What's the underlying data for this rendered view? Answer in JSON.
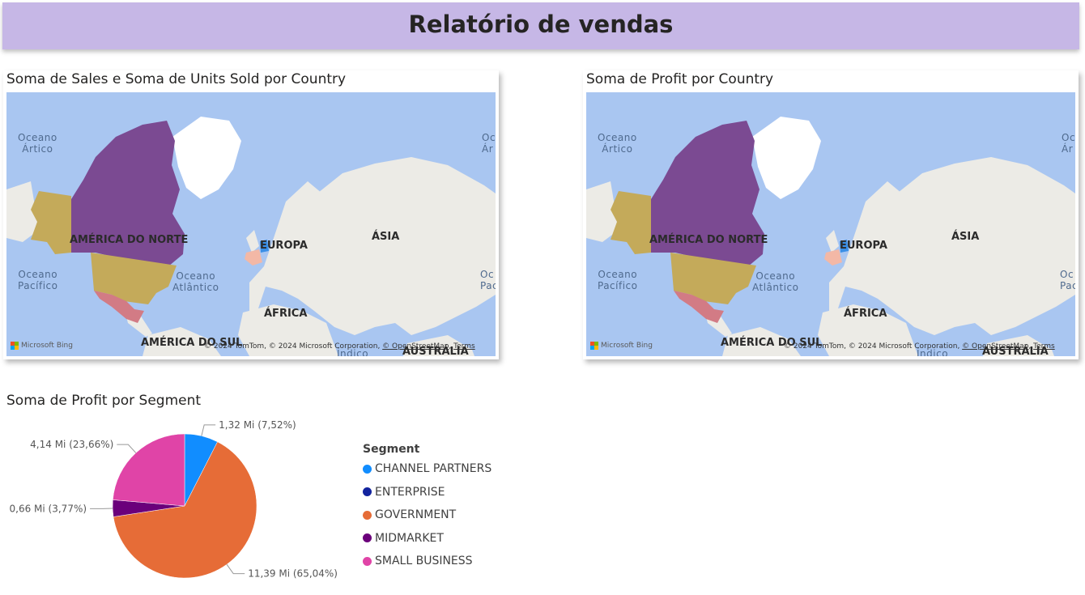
{
  "header": {
    "title": "Relatório de vendas"
  },
  "map1": {
    "title": "Soma de Sales e Soma de Units Sold por Country",
    "labels": {
      "north_america": "AMÉRICA DO NORTE",
      "europe": "EUROPA",
      "asia": "ÁSIA",
      "africa": "ÁFRICA",
      "south_america": "AMÉRICA DO SUL",
      "australia": "AUSTRÁLIA",
      "arctic": "Oceano\nÁrtico",
      "pacific": "Oceano\nPacífico",
      "atlantic": "Oceano\nAtlântico",
      "indian": "Índico",
      "edge_top": "Oc\nÁr",
      "edge_bottom": "Oc\nPac"
    },
    "attribution": {
      "brand": "Microsoft Bing",
      "text": "© 2024 TomTom, © 2024 Microsoft Corporation,",
      "osm": "© OpenStreetMap",
      "terms": "Terms"
    }
  },
  "map2": {
    "title": "Soma de Profit por Country",
    "labels": {
      "north_america": "AMÉRICA DO NORTE",
      "europe": "EUROPA",
      "asia": "ÁSIA",
      "africa": "ÁFRICA",
      "south_america": "AMÉRICA DO SUL",
      "australia": "AUSTRÁLIA",
      "arctic": "Oceano\nÁrtico",
      "pacific": "Oceano\nPacífico",
      "atlantic": "Oceano\nAtlântico",
      "indian": "Índico",
      "edge_top": "Oc\nÁr",
      "edge_bottom": "Oc\nPac"
    },
    "attribution": {
      "brand": "Microsoft Bing",
      "text": "© 2024 TomTom, © 2024 Microsoft Corporation,",
      "osm": "© OpenStreetMap",
      "terms": "Terms"
    }
  },
  "map_colors": {
    "canada": "#7b4a92",
    "usa": "#c4aa5a",
    "alaska": "#c4aa5a",
    "mexico": "#d27b85",
    "germany": "#3a8fe6",
    "france": "#f3b8a6",
    "land": "#ecebe6",
    "greenland": "#ffffff",
    "water": "#a9c6f1"
  },
  "chart_data": {
    "type": "pie",
    "title": "Soma de Profit por Segment",
    "legend_title": "Segment",
    "legend_position": "right",
    "unit": "Mi",
    "series": [
      {
        "name": "CHANNEL PARTNERS",
        "value": 1.32,
        "percent": 7.52,
        "label": "1,32 Mi (7,52%)",
        "color": "#118dff"
      },
      {
        "name": "ENTERPRISE",
        "value": 0.0,
        "percent": 0.0,
        "label": "",
        "color": "#12239e"
      },
      {
        "name": "GOVERNMENT",
        "value": 11.39,
        "percent": 65.04,
        "label": "11,39 Mi (65,04%)",
        "color": "#e66c37"
      },
      {
        "name": "MIDMARKET",
        "value": 0.66,
        "percent": 3.77,
        "label": "0,66 Mi (3,77%)",
        "color": "#6b007b"
      },
      {
        "name": "SMALL BUSINESS",
        "value": 4.14,
        "percent": 23.66,
        "label": "4,14 Mi (23,66%)",
        "color": "#e044a7"
      }
    ]
  }
}
